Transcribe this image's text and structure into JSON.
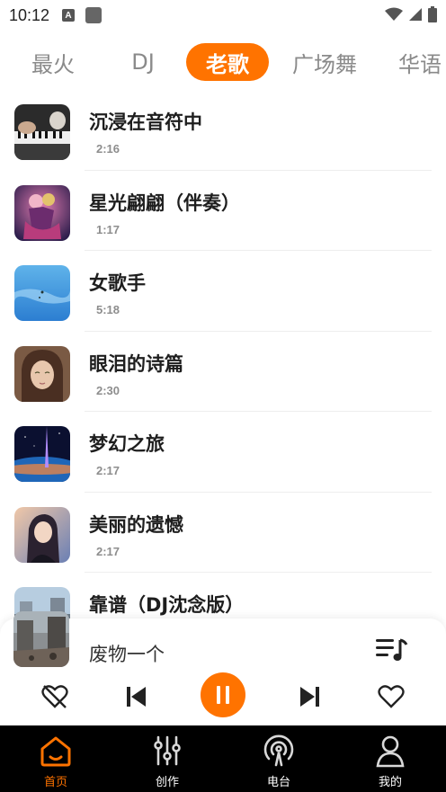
{
  "status_bar": {
    "time": "10:12",
    "notif_letter": "A"
  },
  "tabs": [
    {
      "label": "最火",
      "active": false
    },
    {
      "label": "DJ",
      "active": false
    },
    {
      "label": "老歌",
      "active": true
    },
    {
      "label": "广场舞",
      "active": false
    },
    {
      "label": "华语",
      "active": false
    }
  ],
  "songs": [
    {
      "title": "沉浸在音符中",
      "duration": "2:16",
      "cover_icon": "piano-cover"
    },
    {
      "title": "星光翩翩（伴奏）",
      "duration": "1:17",
      "cover_icon": "dancing-couple-cover"
    },
    {
      "title": "女歌手",
      "duration": "5:18",
      "cover_icon": "blue-sky-cover"
    },
    {
      "title": "眼泪的诗篇",
      "duration": "2:30",
      "cover_icon": "crying-girl-cover"
    },
    {
      "title": "梦幻之旅",
      "duration": "2:17",
      "cover_icon": "earth-space-cover"
    },
    {
      "title": "美丽的遗憾",
      "duration": "2:17",
      "cover_icon": "anime-girl-cover"
    },
    {
      "title": "靠谱（DJ沈念版）",
      "duration": "",
      "cover_icon": "city-street-cover"
    }
  ],
  "player": {
    "title": "废物一个",
    "cover_icon": "ruined-city-cover",
    "accent": "#ff7300"
  },
  "nav": [
    {
      "label": "首页",
      "icon": "home-icon",
      "active": true
    },
    {
      "label": "创作",
      "icon": "sliders-icon",
      "active": false
    },
    {
      "label": "电台",
      "icon": "radio-icon",
      "active": false
    },
    {
      "label": "我的",
      "icon": "person-icon",
      "active": false
    }
  ],
  "colors": {
    "accent": "#ff7300",
    "nav_bg": "#000000"
  }
}
